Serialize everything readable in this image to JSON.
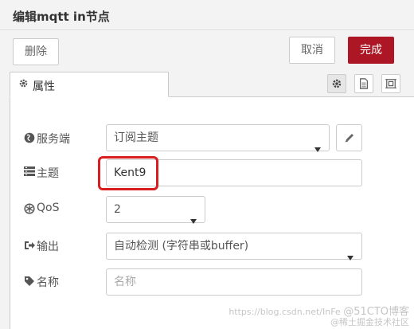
{
  "dialog": {
    "title": "编辑mqtt in节点"
  },
  "toolbar": {
    "delete_label": "删除",
    "cancel_label": "取消",
    "done_label": "完成",
    "done_color": "#ad1625"
  },
  "tabs": {
    "properties_label": "属性",
    "properties_icon": "gear-icon",
    "side_icons": [
      "gear-icon",
      "document-icon",
      "frame-icon"
    ]
  },
  "form": {
    "broker": {
      "label": "服务端",
      "icon": "globe-icon",
      "value": "订阅主题"
    },
    "topic": {
      "label": "主题",
      "icon": "list-icon",
      "value": "Kent9"
    },
    "qos": {
      "label": "QoS",
      "icon": "qos-icon",
      "value": "2"
    },
    "output": {
      "label": "输出",
      "icon": "sign-out-icon",
      "value": "自动检测 (字符串或buffer)"
    },
    "name": {
      "label": "名称",
      "icon": "tag-icon",
      "placeholder": "名称"
    }
  },
  "annotation": {
    "highlight_color": "#d81e1e"
  },
  "watermark": {
    "url_text": "https://blog.csdn.net/InFe",
    "brand_text": "@51CTO博客",
    "sub_text": "@稀土掘金技术社区"
  }
}
